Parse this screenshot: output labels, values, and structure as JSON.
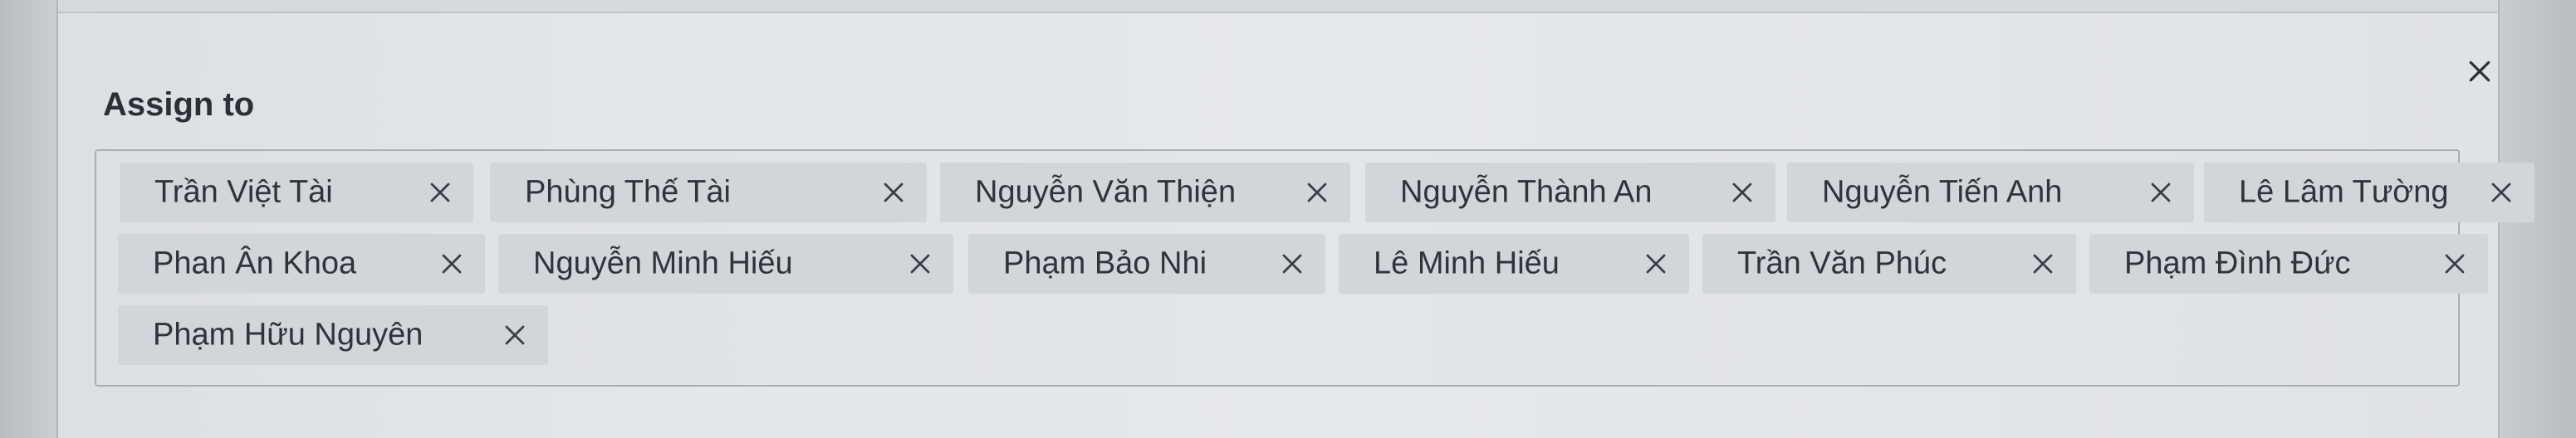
{
  "dialog": {
    "label": "Assign to",
    "close_icon": "close-icon"
  },
  "assignees": [
    {
      "name": "Trần Việt Tài",
      "remove_icon": "close-icon"
    },
    {
      "name": "Phùng Thế Tài",
      "remove_icon": "close-icon"
    },
    {
      "name": "Nguyễn Văn Thiện",
      "remove_icon": "close-icon"
    },
    {
      "name": "Nguyễn Thành An",
      "remove_icon": "close-icon"
    },
    {
      "name": "Nguyễn Tiến Anh",
      "remove_icon": "close-icon"
    },
    {
      "name": "Lê Lâm Tường",
      "remove_icon": "close-icon"
    },
    {
      "name": "Phan Ân Khoa",
      "remove_icon": "close-icon"
    },
    {
      "name": "Nguyễn Minh Hiếu",
      "remove_icon": "close-icon"
    },
    {
      "name": "Phạm Bảo Nhi",
      "remove_icon": "close-icon"
    },
    {
      "name": "Lê Minh Hiếu",
      "remove_icon": "close-icon"
    },
    {
      "name": "Trần Văn Phúc",
      "remove_icon": "close-icon"
    },
    {
      "name": "Phạm Đình Đức",
      "remove_icon": "close-icon"
    },
    {
      "name": "Phạm Hữu Nguyên",
      "remove_icon": "close-icon"
    }
  ]
}
